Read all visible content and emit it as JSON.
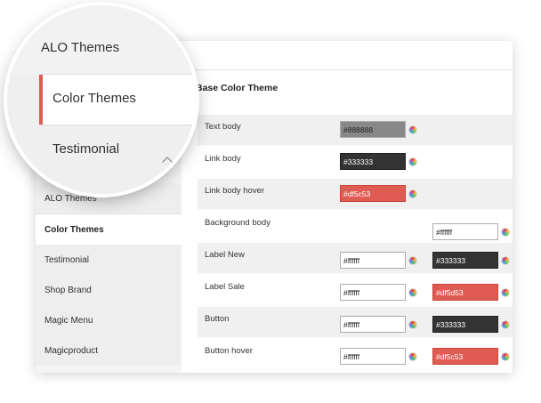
{
  "magnifier": {
    "items": [
      "ALO Themes",
      "Color Themes",
      "Testimonial"
    ]
  },
  "sidebar": {
    "items": [
      {
        "label": "ALO Themes"
      },
      {
        "label": "Color Themes"
      },
      {
        "label": "Testimonial"
      },
      {
        "label": "Shop Brand"
      },
      {
        "label": "Magic Menu"
      },
      {
        "label": "Magicproduct"
      }
    ]
  },
  "section": {
    "title": "Base Color Theme",
    "rows": [
      {
        "label": "Text body",
        "v1": "#888888",
        "v2": ""
      },
      {
        "label": "Link body",
        "v1": "#333333",
        "v2": ""
      },
      {
        "label": "Link body hover",
        "v1": "#df5c53",
        "v2": ""
      },
      {
        "label": "Background body",
        "v1": "",
        "v2": "#ffffff"
      },
      {
        "label": "Label New",
        "v1": "#ffffff",
        "v2": "#333333"
      },
      {
        "label": "Label Sale",
        "v1": "#ffffff",
        "v2": "#df5d53"
      },
      {
        "label": "Button",
        "v1": "#ffffff",
        "v2": "#333333"
      },
      {
        "label": "Button hover",
        "v1": "#ffffff",
        "v2": "#df5c53"
      }
    ]
  },
  "colors": {
    "accent": "#df5c53",
    "dark": "#333333",
    "grey": "#888888"
  }
}
